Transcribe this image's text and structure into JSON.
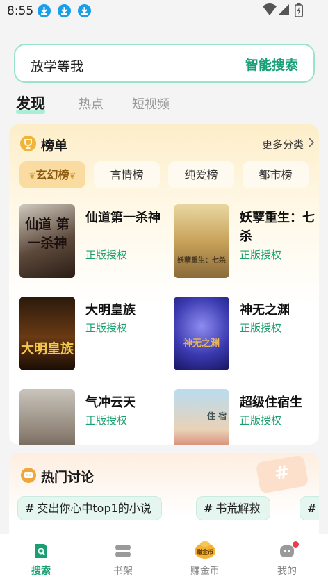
{
  "status_bar": {
    "time": "8:55",
    "download_icons": [
      "download-icon",
      "download-icon",
      "download-icon"
    ]
  },
  "search": {
    "query": "放学等我",
    "button": "智能搜索"
  },
  "tabs": [
    "发现",
    "热点",
    "短视频"
  ],
  "ranking": {
    "title": "榜单",
    "more": "更多分类",
    "categories": [
      "玄幻榜",
      "言情榜",
      "纯爱榜",
      "都市榜"
    ],
    "books": [
      {
        "name": "仙道第一杀神",
        "badge": "正版授权",
        "cover_text": "仙道 第一杀神"
      },
      {
        "name": "妖孽重生：七杀",
        "badge": "正版授权",
        "cover_text": "妖孽重生：七杀"
      },
      {
        "name": "大明皇族",
        "badge": "正版授权",
        "cover_text": "大明皇族"
      },
      {
        "name": "神无之渊",
        "badge": "正版授权",
        "cover_text": "神无之渊"
      },
      {
        "name": "气冲云天",
        "badge": "正版授权",
        "cover_text": ""
      },
      {
        "name": "超级住宿生",
        "badge": "正版授权",
        "cover_text": "住 宿"
      }
    ]
  },
  "discussion": {
    "title": "热门讨论",
    "topics": [
      "交出你心中top1的小说",
      "书荒解救"
    ]
  },
  "bottom_nav": [
    "搜索",
    "书架",
    "赚金币",
    "我的"
  ],
  "coin_badge": "赚金币",
  "colors": {
    "accent": "#1aa06e",
    "search_border": "#9be3cf",
    "card_bg": "#fdeec9"
  }
}
